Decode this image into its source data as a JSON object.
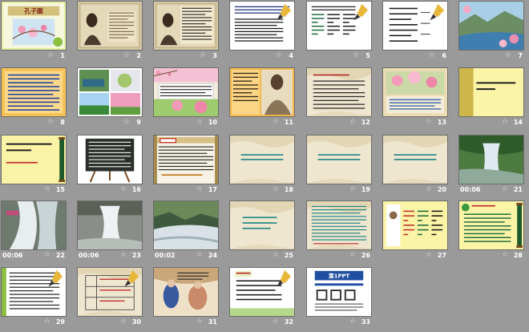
{
  "slides": [
    {
      "num": "1",
      "time": "",
      "title": "孔子圖",
      "kind": "cover"
    },
    {
      "num": "2",
      "time": "",
      "title": "",
      "kind": "portrait"
    },
    {
      "num": "3",
      "time": "",
      "title": "",
      "kind": "portrait-text"
    },
    {
      "num": "4",
      "time": "",
      "title": "",
      "kind": "text-white"
    },
    {
      "num": "5",
      "time": "",
      "title": "",
      "kind": "table-pen"
    },
    {
      "num": "6",
      "time": "",
      "title": "",
      "kind": "list-pen"
    },
    {
      "num": "7",
      "time": "",
      "title": "",
      "kind": "landscape"
    },
    {
      "num": "8",
      "time": "",
      "title": "",
      "kind": "orange-text"
    },
    {
      "num": "9",
      "time": "",
      "title": "",
      "kind": "collage"
    },
    {
      "num": "10",
      "time": "",
      "title": "",
      "kind": "blossom-text"
    },
    {
      "num": "11",
      "time": "",
      "title": "",
      "kind": "orange-portrait"
    },
    {
      "num": "12",
      "time": "",
      "title": "",
      "kind": "table-paper"
    },
    {
      "num": "13",
      "time": "",
      "title": "",
      "kind": "blossom-photo"
    },
    {
      "num": "14",
      "time": "",
      "title": "孔子的鐵誨雕塑作",
      "kind": "yellow-title"
    },
    {
      "num": "15",
      "time": "",
      "title": "孔子的鐵誨雕塑作",
      "kind": "yellow-scroll"
    },
    {
      "num": "16",
      "time": "",
      "title": "",
      "kind": "easel"
    },
    {
      "num": "17",
      "time": "",
      "title": "",
      "kind": "frame-text"
    },
    {
      "num": "18",
      "time": "",
      "title": "",
      "kind": "paper-teal"
    },
    {
      "num": "19",
      "time": "",
      "title": "",
      "kind": "paper-teal"
    },
    {
      "num": "20",
      "time": "",
      "title": "",
      "kind": "paper-teal"
    },
    {
      "num": "21",
      "time": "00:06",
      "title": "",
      "kind": "waterfall-green"
    },
    {
      "num": "22",
      "time": "00:06",
      "title": "",
      "kind": "waterfall"
    },
    {
      "num": "23",
      "time": "00:06",
      "title": "",
      "kind": "waterfall-white"
    },
    {
      "num": "24",
      "time": "00:02",
      "title": "",
      "kind": "river"
    },
    {
      "num": "25",
      "time": "",
      "title": "",
      "kind": "paper-teal-short"
    },
    {
      "num": "26",
      "time": "",
      "title": "",
      "kind": "paper-long"
    },
    {
      "num": "27",
      "time": "",
      "title": "",
      "kind": "yellow-table"
    },
    {
      "num": "28",
      "time": "",
      "title": "說說",
      "kind": "yellow-scroll-green"
    },
    {
      "num": "29",
      "time": "",
      "title": "",
      "kind": "green-text"
    },
    {
      "num": "30",
      "time": "",
      "title": "",
      "kind": "table-paper2"
    },
    {
      "num": "31",
      "time": "",
      "title": "",
      "kind": "painting"
    },
    {
      "num": "32",
      "time": "",
      "title": "",
      "kind": "list-pen2"
    },
    {
      "num": "33",
      "time": "",
      "title": "第1PPT",
      "kind": "ad"
    }
  ],
  "star_glyph": "☆"
}
